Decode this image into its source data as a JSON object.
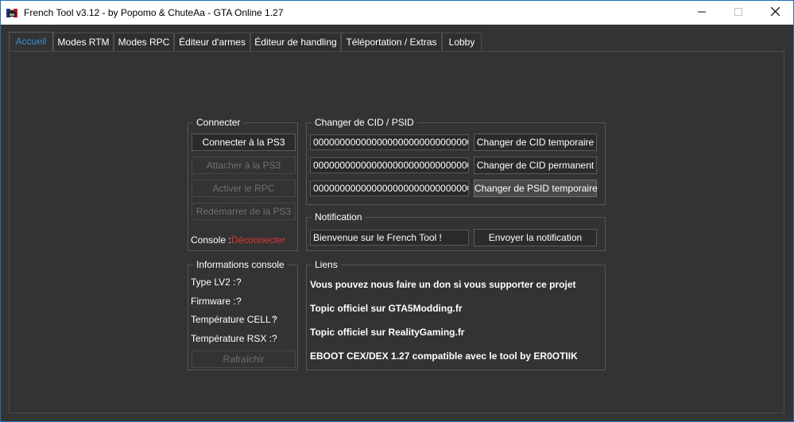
{
  "window": {
    "title": "French Tool v3.12 - by Popomo & ChuteAa - GTA Online 1.27",
    "controls": {
      "minimize": "minimize-icon",
      "maximize": "maximize-icon",
      "close": "close-icon"
    }
  },
  "tabs": [
    {
      "label": "Accueil",
      "active": true
    },
    {
      "label": "Modes RTM",
      "active": false
    },
    {
      "label": "Modes RPC",
      "active": false
    },
    {
      "label": "Éditeur d'armes",
      "active": false
    },
    {
      "label": "Éditeur de handling",
      "active": false
    },
    {
      "label": "Téléportation / Extras",
      "active": false
    },
    {
      "label": "Lobby",
      "active": false
    }
  ],
  "connect": {
    "title": "Connecter",
    "connect_button": "Connecter à la PS3",
    "attach_button": "Attacher à la PS3",
    "rpc_button": "Activer le RPC",
    "restart_button": "Redémarrer de la PS3",
    "console_label": "Console :",
    "console_status": "Déconnecter"
  },
  "cid": {
    "title": "Changer de CID / PSID",
    "cid_temp_value": "0000000000000000000000000000000",
    "cid_perm_value": "0000000000000000000000000000000",
    "psid_temp_value": "0000000000000000000000000000000",
    "cid_temp_button": "Changer de CID temporaire",
    "cid_perm_button": "Changer de CID permanent",
    "psid_temp_button": "Changer de PSID temporaire"
  },
  "notification": {
    "title": "Notification",
    "message_value": "Bienvenue sur le French Tool !",
    "send_button": "Envoyer la notification"
  },
  "console_info": {
    "title": "Informations console",
    "rows": [
      {
        "label": "Type LV2 :",
        "value": "?"
      },
      {
        "label": "Firmware :",
        "value": "?"
      },
      {
        "label": "Température CELL :",
        "value": "?"
      },
      {
        "label": "Température RSX :",
        "value": "?"
      }
    ],
    "refresh_button": "Rafraîchir"
  },
  "links": {
    "title": "Liens",
    "items": [
      "Vous pouvez nous faire un don si vous supporter ce projet",
      "Topic officiel sur GTA5Modding.fr",
      "Topic officiel sur RealityGaming.fr",
      "EBOOT CEX/DEX 1.27 compatible avec le tool by ER0OTIIK"
    ]
  },
  "colors": {
    "background": "#333333",
    "active_tab": "#3c8ed4",
    "status_disconnected": "#e53333",
    "window_border": "#1e6fb8"
  }
}
